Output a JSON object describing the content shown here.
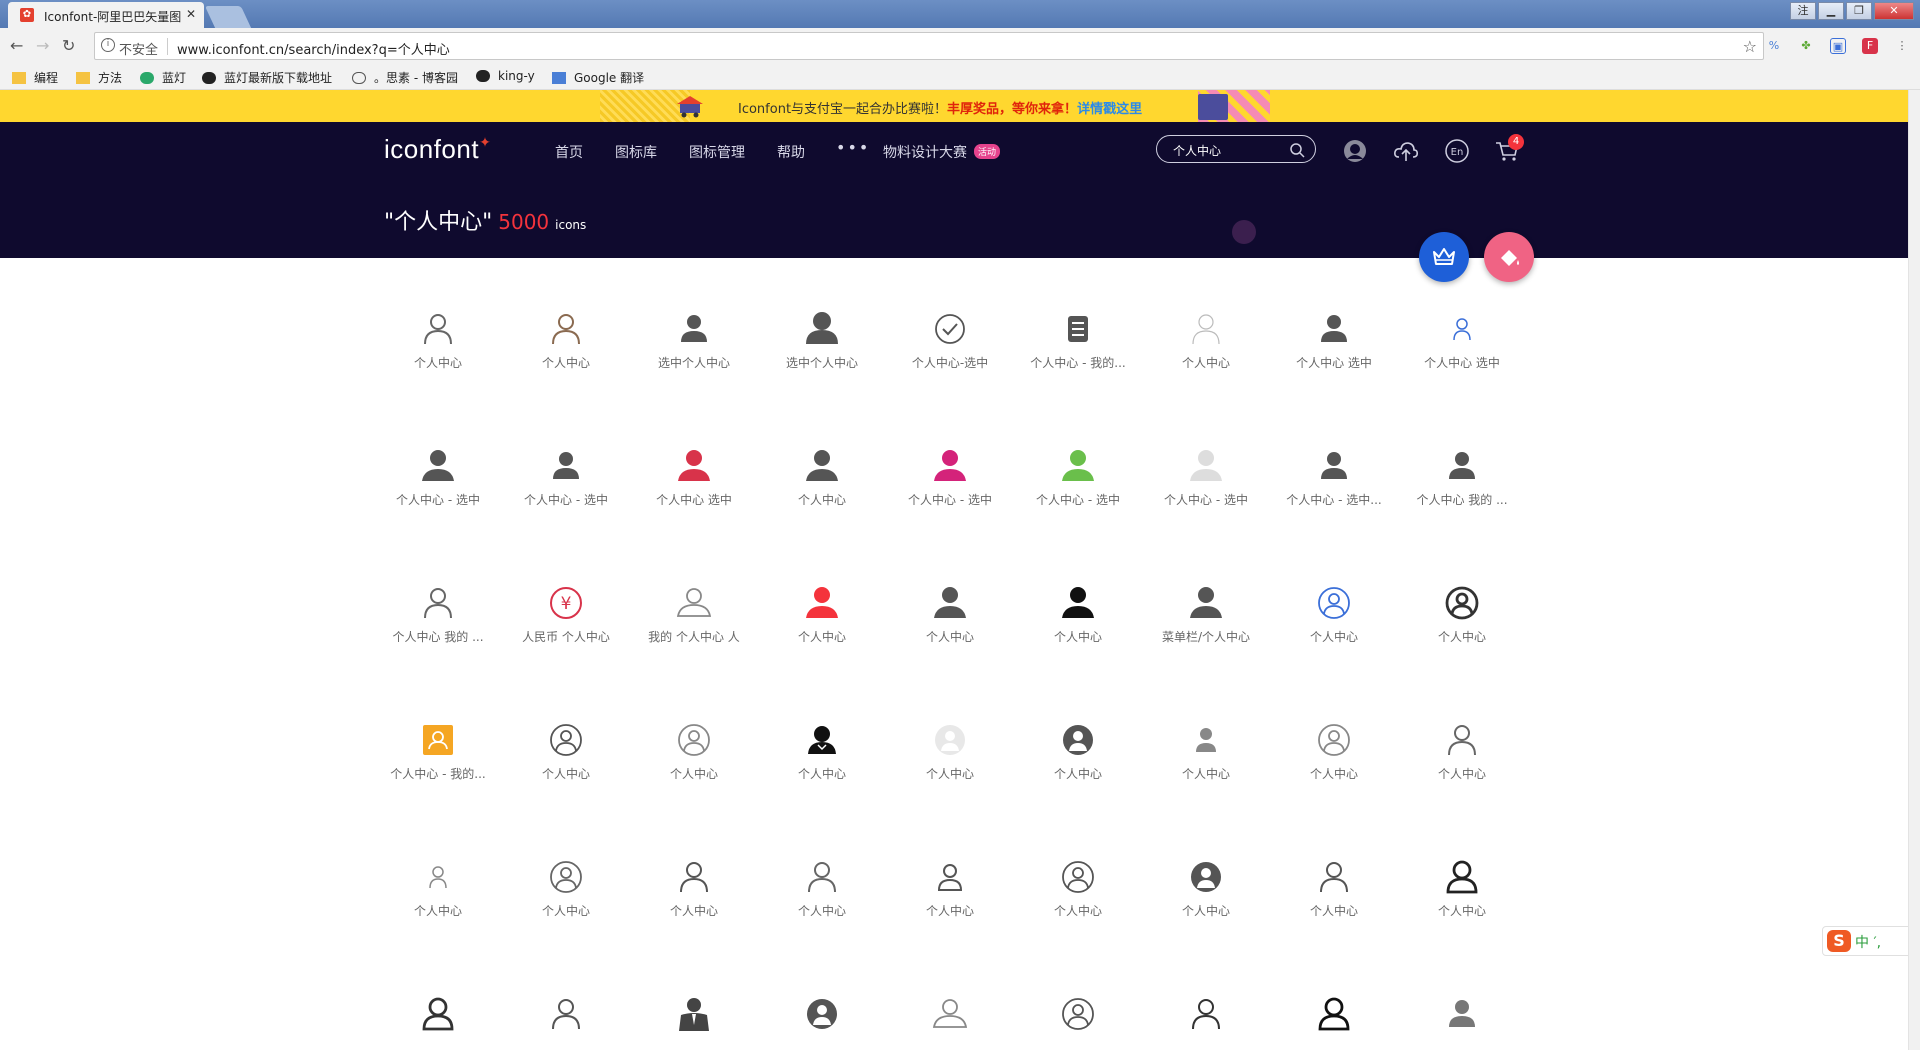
{
  "browser": {
    "tab_title": "Iconfont-阿里巴巴矢量图",
    "tab_close": "✕",
    "insecure_label": "不安全",
    "url": "www.iconfont.cn/search/index?q=个人中心",
    "bookmarks": [
      "编程",
      "方法",
      "蓝灯",
      "蓝灯最新版下载地址",
      "。思素 - 博客园",
      "king-y",
      "Google 翻译"
    ]
  },
  "banner": {
    "text_lead": "Iconfont与支付宝一起合办比赛啦！",
    "text_prize": "丰厚奖品，等你来拿！",
    "text_link": "详情戳这里"
  },
  "header": {
    "logo": "iconfont",
    "nav": [
      "首页",
      "图标库",
      "图标管理",
      "帮助"
    ],
    "more": "•••",
    "contest": "物料设计大赛",
    "contest_badge": "活动",
    "search_value": "个人中心",
    "cart_count": "4",
    "result_query": "\"个人中心\"",
    "result_count": "5000",
    "result_unit": "icons"
  },
  "colors": {
    "banner": "#ffd72f",
    "hero": "#0f0a2e",
    "accent_red": "#f4333c",
    "fab_blue": "#1e5fd8",
    "fab_pink": "#f06384"
  },
  "icons": [
    {
      "label": "个人中心",
      "style": "outline",
      "color": "#666"
    },
    {
      "label": "个人中心",
      "style": "outline",
      "color": "#8a6a50"
    },
    {
      "label": "选中个人中心",
      "style": "filled",
      "color": "#555"
    },
    {
      "label": "选中个人中心",
      "style": "filled-large",
      "color": "#555"
    },
    {
      "label": "个人中心-选中",
      "style": "check-circle",
      "color": "#555"
    },
    {
      "label": "个人中心 - 我的...",
      "style": "notebook",
      "color": "#555"
    },
    {
      "label": "个人中心",
      "style": "outline-thin",
      "color": "#bbb"
    },
    {
      "label": "个人中心 选中",
      "style": "filled",
      "color": "#555"
    },
    {
      "label": "个人中心 选中",
      "style": "outline-small",
      "color": "#3b6fd8"
    },
    {
      "label": "个人中心 - 选中",
      "style": "bust",
      "color": "#555"
    },
    {
      "label": "个人中心 - 选中",
      "style": "filled",
      "color": "#555"
    },
    {
      "label": "个人中心 选中",
      "style": "bust",
      "color": "#d8334a"
    },
    {
      "label": "个人中心",
      "style": "bust",
      "color": "#555"
    },
    {
      "label": "个人中心 - 选中",
      "style": "bust",
      "color": "#d4237a"
    },
    {
      "label": "个人中心 - 选中",
      "style": "bust",
      "color": "#6abf4b"
    },
    {
      "label": "个人中心 - 选中",
      "style": "bust",
      "color": "#ddd"
    },
    {
      "label": "个人中心 - 选中...",
      "style": "filled",
      "color": "#555"
    },
    {
      "label": "个人中心 我的 ...",
      "style": "filled",
      "color": "#555"
    },
    {
      "label": "个人中心 我的 ...",
      "style": "outline",
      "color": "#666"
    },
    {
      "label": "人民币 个人中心",
      "style": "yen",
      "color": "#d8334a"
    },
    {
      "label": "我的 个人中心 人",
      "style": "outline-wide",
      "color": "#888"
    },
    {
      "label": "个人中心",
      "style": "bust",
      "color": "#f4333c"
    },
    {
      "label": "个人中心",
      "style": "bust",
      "color": "#555"
    },
    {
      "label": "个人中心",
      "style": "bust",
      "color": "#111"
    },
    {
      "label": "菜单栏/个人中心",
      "style": "bust",
      "color": "#555"
    },
    {
      "label": "个人中心",
      "style": "circle-outline",
      "color": "#3b6fd8"
    },
    {
      "label": "个人中心",
      "style": "circle-outline-bold",
      "color": "#333"
    },
    {
      "label": "个人中心 - 我的...",
      "style": "orange-square",
      "color": "#f5a623"
    },
    {
      "label": "个人中心",
      "style": "circle-outline",
      "color": "#555"
    },
    {
      "label": "个人中心",
      "style": "circle-outline",
      "color": "#888"
    },
    {
      "label": "个人中心",
      "style": "dark-person",
      "color": "#111"
    },
    {
      "label": "个人中心",
      "style": "circle-filled",
      "color": "#e8e8e8"
    },
    {
      "label": "个人中心",
      "style": "circle-filled-dark",
      "color": "#555"
    },
    {
      "label": "个人中心",
      "style": "filled-small",
      "color": "#888"
    },
    {
      "label": "个人中心",
      "style": "circle-outline",
      "color": "#888"
    },
    {
      "label": "个人中心",
      "style": "outline",
      "color": "#666"
    },
    {
      "label": "个人中心",
      "style": "outline-small",
      "color": "#888"
    },
    {
      "label": "个人中心",
      "style": "circle-outline",
      "color": "#666"
    },
    {
      "label": "个人中心",
      "style": "outline",
      "color": "#555"
    },
    {
      "label": "个人中心",
      "style": "outline",
      "color": "#666"
    },
    {
      "label": "个人中心",
      "style": "outline-box",
      "color": "#555"
    },
    {
      "label": "个人中心",
      "style": "circle-outline",
      "color": "#555"
    },
    {
      "label": "个人中心",
      "style": "circle-filled-dark",
      "color": "#555"
    },
    {
      "label": "个人中心",
      "style": "outline",
      "color": "#555"
    },
    {
      "label": "个人中心",
      "style": "outline-bold",
      "color": "#222"
    },
    {
      "label": "",
      "style": "outline-bold",
      "color": "#333"
    },
    {
      "label": "",
      "style": "outline",
      "color": "#555"
    },
    {
      "label": "",
      "style": "suit",
      "color": "#444"
    },
    {
      "label": "",
      "style": "circle-filled-dark",
      "color": "#555"
    },
    {
      "label": "",
      "style": "outline-wide",
      "color": "#888"
    },
    {
      "label": "",
      "style": "circle-outline",
      "color": "#555"
    },
    {
      "label": "",
      "style": "outline",
      "color": "#333"
    },
    {
      "label": "",
      "style": "outline-bold",
      "color": "#111"
    },
    {
      "label": "",
      "style": "filled",
      "color": "#777"
    }
  ],
  "ime": {
    "label": "中 ′,",
    "logo": "S"
  }
}
